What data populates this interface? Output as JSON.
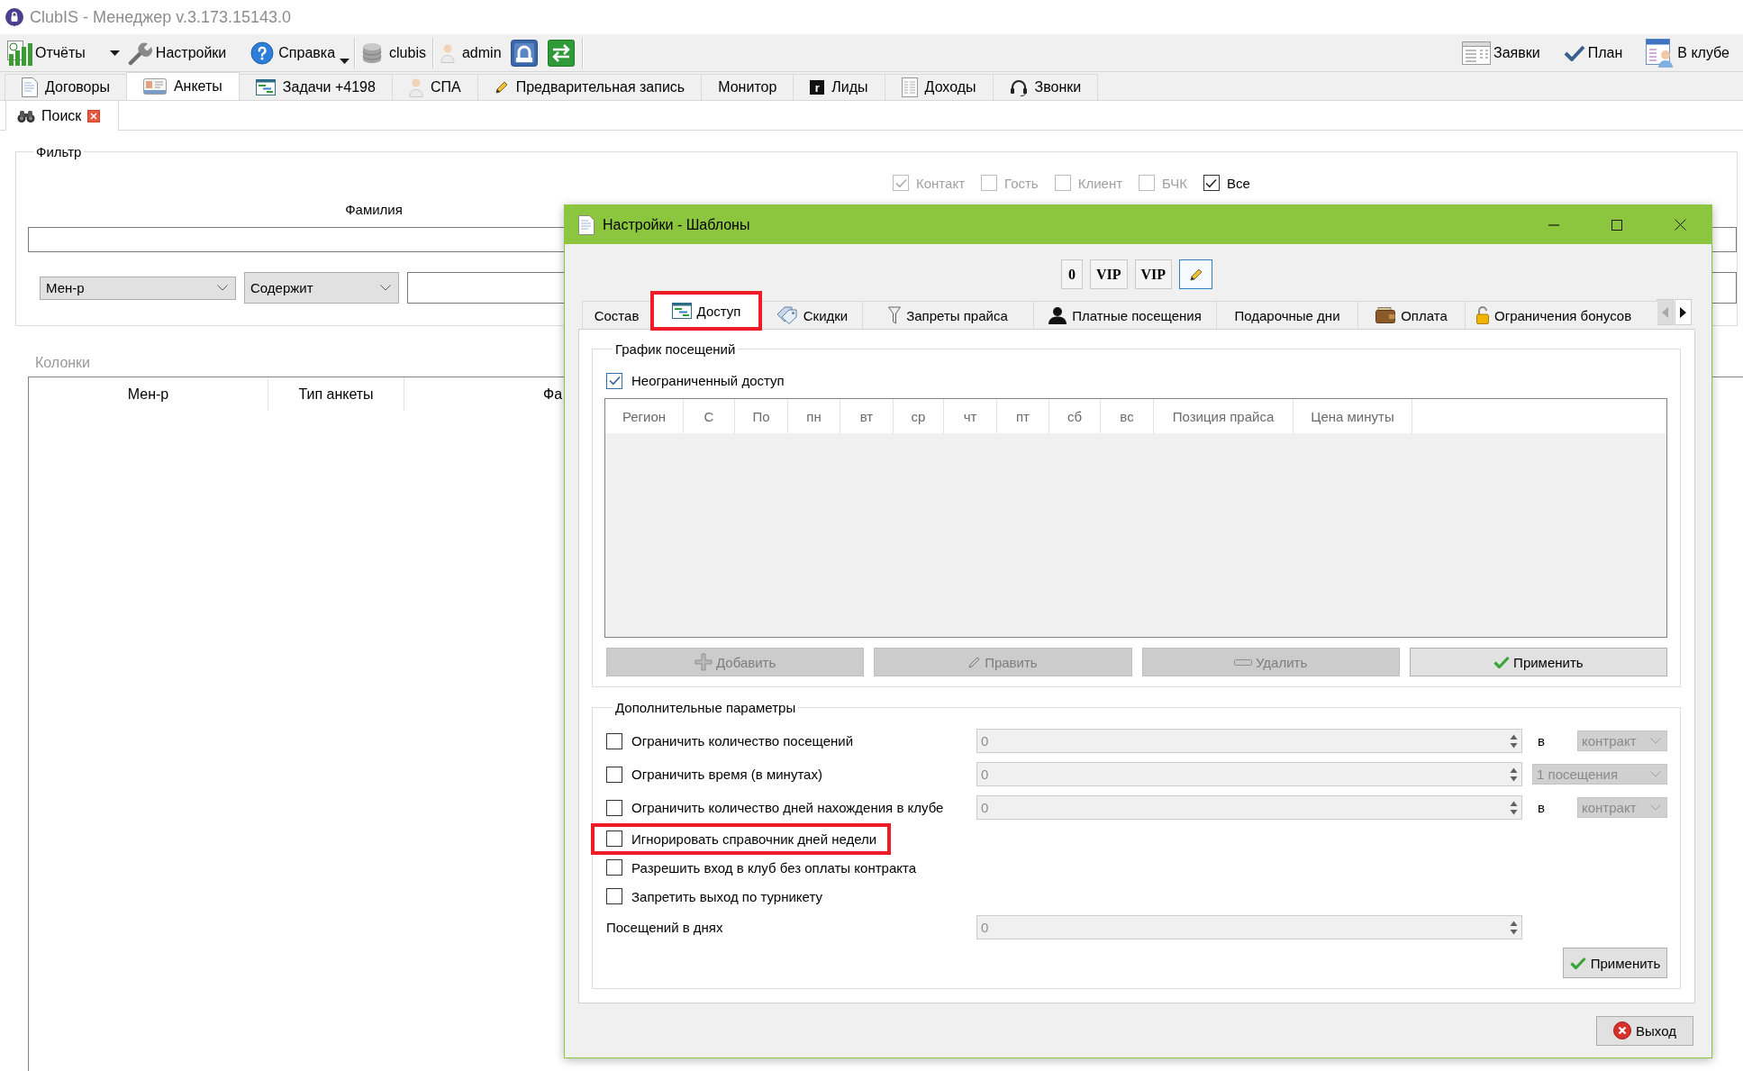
{
  "window": {
    "title": "ClubIS - Менеджер v.3.173.15143.0"
  },
  "toolbar": {
    "left": [
      {
        "kind": "split",
        "label": "Отчёты"
      },
      {
        "kind": "button",
        "label": "Настройки"
      },
      {
        "kind": "dropdown",
        "label": "Справка"
      },
      {
        "kind": "separator"
      },
      {
        "kind": "label",
        "label": "clubis"
      },
      {
        "kind": "separator"
      },
      {
        "kind": "label",
        "label": "admin"
      },
      {
        "kind": "icon"
      },
      {
        "kind": "icon"
      },
      {
        "kind": "separator"
      }
    ],
    "right": [
      {
        "label": "Заявки"
      },
      {
        "label": "План"
      },
      {
        "label": "В клубе"
      }
    ]
  },
  "main_tabs": [
    {
      "label": "Договоры",
      "selected": false
    },
    {
      "label": "Анкеты",
      "selected": true
    },
    {
      "label": "Задачи +4198",
      "selected": false
    },
    {
      "label": "СПА",
      "selected": false
    },
    {
      "label": "Предварительная запись",
      "selected": false
    },
    {
      "label": "Монитор",
      "selected": false
    },
    {
      "label": "Лиды",
      "selected": false,
      "logo": "r"
    },
    {
      "label": "Доходы",
      "selected": false
    },
    {
      "label": "Звонки",
      "selected": false
    }
  ],
  "sub_tabs": [
    {
      "label": "Поиск",
      "selected": true,
      "closable": true
    }
  ],
  "filter": {
    "title": "Фильтр",
    "types": [
      {
        "label": "Контакт",
        "checked": true,
        "disabled": true
      },
      {
        "label": "Гость",
        "checked": false,
        "disabled": true
      },
      {
        "label": "Клиент",
        "checked": false,
        "disabled": true
      },
      {
        "label": "БЧК",
        "checked": false,
        "disabled": true
      },
      {
        "label": "Все",
        "checked": true,
        "disabled": false
      }
    ],
    "surname_label": "Фамилия",
    "field_select": "Мен-р",
    "condition_select": "Содержит"
  },
  "columns": {
    "title": "Колонки",
    "headers": [
      "Мен-р",
      "Тип анкеты",
      "Фа"
    ]
  },
  "dialog": {
    "title": "Настройки - Шаблоны",
    "top_buttons": [
      {
        "kind": "text",
        "label": "0",
        "selected": false
      },
      {
        "kind": "text",
        "label": "VIP",
        "selected": false
      },
      {
        "kind": "text",
        "label": "VIP",
        "selected": false
      },
      {
        "kind": "edit",
        "selected": true
      }
    ],
    "tabs": [
      {
        "label": "Состав",
        "selected": false,
        "highlighted": false
      },
      {
        "label": "Доступ",
        "selected": true,
        "highlighted": true
      },
      {
        "label": "Скидки",
        "selected": false,
        "highlighted": false
      },
      {
        "label": "Запреты прайса",
        "selected": false,
        "highlighted": false
      },
      {
        "label": "Платные посещения",
        "selected": false,
        "highlighted": false
      },
      {
        "label": "Подарочные дни",
        "selected": false,
        "highlighted": false
      },
      {
        "label": "Оплата",
        "selected": false,
        "highlighted": false
      },
      {
        "label": "Ограничения бонусов",
        "selected": false,
        "highlighted": false
      }
    ],
    "schedule": {
      "title": "График посещений",
      "unlimited": {
        "label": "Неограниченный доступ",
        "checked": true
      },
      "columns": [
        "Регион",
        "С",
        "По",
        "пн",
        "вт",
        "ср",
        "чт",
        "пт",
        "сб",
        "вс",
        "Позиция прайса",
        "Цена минуты"
      ],
      "buttons": [
        {
          "label": "Добавить",
          "disabled": true
        },
        {
          "label": "Править",
          "disabled": true
        },
        {
          "label": "Удалить",
          "disabled": true
        },
        {
          "label": "Применить",
          "disabled": false
        }
      ]
    },
    "extra": {
      "title": "Дополнительные параметры",
      "rows": [
        {
          "kind": "checkbox",
          "label": "Ограничить количество посещений",
          "checked": false,
          "highlighted": false,
          "field": {
            "value": "0",
            "disabled": true
          },
          "unit": "в",
          "select": {
            "value": "контракт",
            "disabled": true
          }
        },
        {
          "kind": "checkbox",
          "label": "Ограничить время (в минутах)",
          "checked": false,
          "highlighted": false,
          "field": {
            "value": "0",
            "disabled": true
          },
          "select": {
            "value": "1 посещения",
            "disabled": true
          }
        },
        {
          "kind": "checkbox",
          "label": "Ограничить количество дней нахождения в клубе",
          "checked": false,
          "highlighted": false,
          "field": {
            "value": "0",
            "disabled": true
          },
          "unit": "в",
          "select": {
            "value": "контракт",
            "disabled": true
          }
        },
        {
          "kind": "checkbox",
          "label": "Игнорировать справочник дней недели",
          "checked": false,
          "highlighted": true
        },
        {
          "kind": "checkbox",
          "label": "Разрешить вход в клуб без оплаты контракта",
          "checked": false,
          "highlighted": false
        },
        {
          "kind": "checkbox",
          "label": "Запретить выход по турникету",
          "checked": false,
          "highlighted": false
        },
        {
          "kind": "number",
          "label": "Посещений в днях",
          "highlighted": false,
          "field": {
            "value": "0",
            "disabled": true
          }
        }
      ],
      "apply": "Применить"
    },
    "exit": "Выход"
  }
}
